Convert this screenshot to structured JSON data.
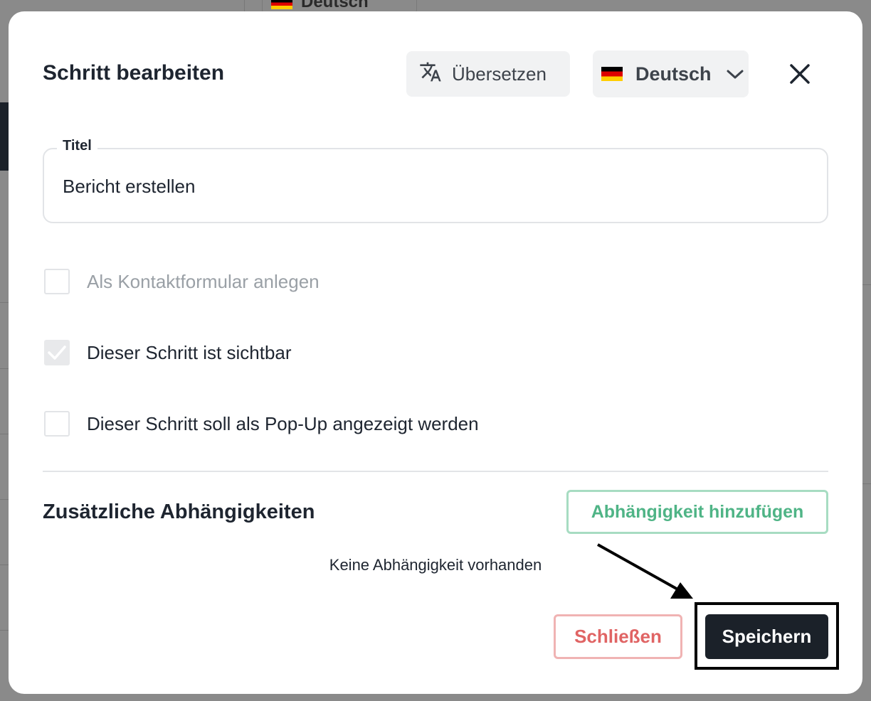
{
  "background": {
    "language": "Deutsch"
  },
  "dialog": {
    "title": "Schritt bearbeiten",
    "translate_label": "Übersetzen",
    "language": {
      "selected": "Deutsch",
      "flag_icon": "flag-de-icon"
    },
    "close_icon": "close-icon"
  },
  "form": {
    "title_label": "Titel",
    "title_value": "Bericht erstellen",
    "checkboxes": [
      {
        "label": "Als Kontaktformular anlegen",
        "checked": false,
        "disabled": true
      },
      {
        "label": "Dieser Schritt ist sichtbar",
        "checked": true,
        "disabled": true
      },
      {
        "label": "Dieser Schritt soll als Pop-Up angezeigt werden",
        "checked": false,
        "disabled": false
      }
    ]
  },
  "dependencies": {
    "title": "Zusätzliche Abhängigkeiten",
    "add_label": "Abhängigkeit hinzufügen",
    "empty_message": "Keine Abhängigkeit vorhanden"
  },
  "footer": {
    "cancel_label": "Schließen",
    "save_label": "Speichern"
  },
  "colors": {
    "primary": "#1b2129",
    "success": "#4fb486",
    "danger": "#e06464"
  }
}
